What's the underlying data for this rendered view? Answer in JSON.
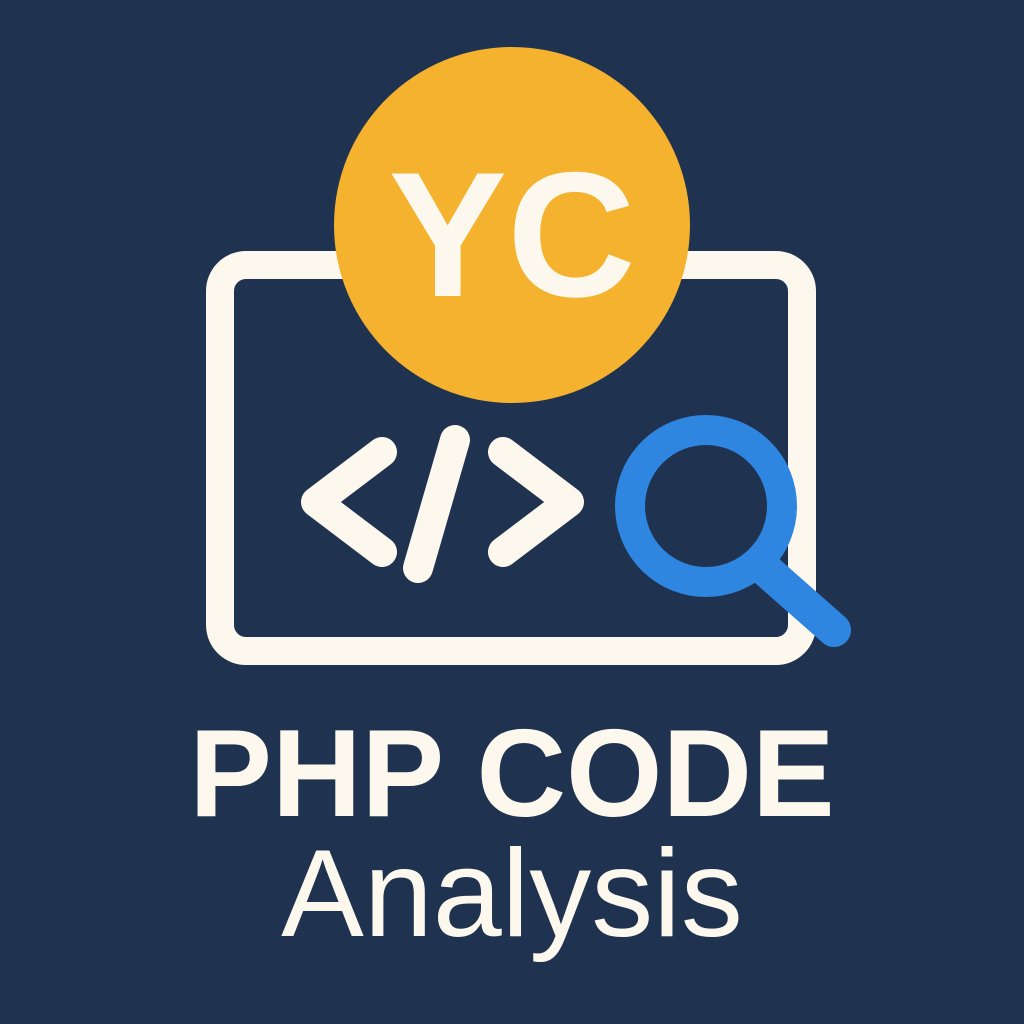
{
  "colors": {
    "background": "#1f3350",
    "cream": "#fdf8ed",
    "badge": "#f4b22e",
    "magnifier": "#2f86e0"
  },
  "badge": {
    "text": "YC"
  },
  "icons": {
    "screen": "monitor-frame-icon",
    "code": "code-brackets-icon",
    "search": "magnifying-glass-icon"
  },
  "title": {
    "line1": "PHP CODE",
    "line2": "Analysis"
  }
}
